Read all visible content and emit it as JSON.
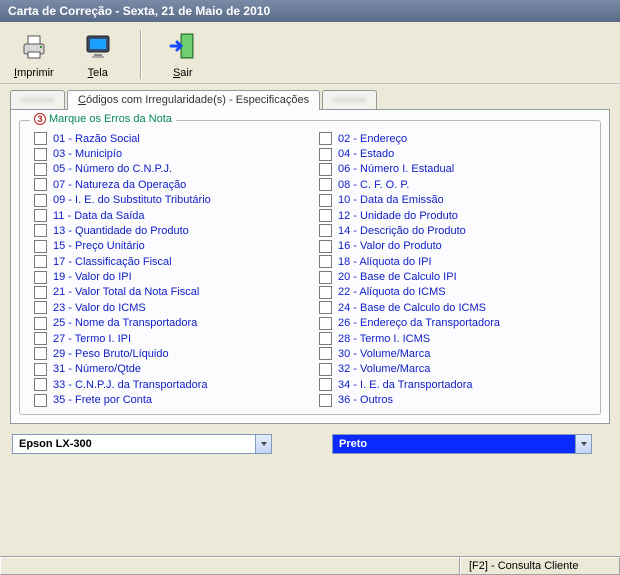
{
  "window": {
    "title": "Carta de Correção - Sexta, 21 de Maio de 2010"
  },
  "toolbar": {
    "print": "Imprimir",
    "screen": "Tela",
    "exit": "Sair"
  },
  "tabs": {
    "tab1": "———",
    "tab2": "Códigos com Irregularidade(s) - Especificações",
    "tab3": "———"
  },
  "fieldset": {
    "badge": "3",
    "legend": "Marque os Erros da Nota"
  },
  "errors_left": [
    "01 - Razão Social",
    "03 - Municipío",
    "05 - Número do C.N.P.J.",
    "07 - Natureza da Operação",
    "09 - I. E. do Substituto Tributário",
    "11 - Data da Saída",
    "13 - Quantidade do Produto",
    "15 - Preço Unitário",
    "17 - Classificação Fiscal",
    "19 - Valor do IPI",
    "21 - Valor Total da Nota Fiscal",
    "23 - Valor do ICMS",
    "25 - Nome da Transportadora",
    "27 - Termo I. IPI",
    "29 - Peso Bruto/Líquido",
    "31 - Número/Qtde",
    "33 - C.N.P.J. da Transportadora",
    "35 - Frete por Conta"
  ],
  "errors_right": [
    "02 - Endereço",
    "04 - Estado",
    "06 - Número I. Estadual",
    "08 - C. F. O. P.",
    "10 - Data da Emissão",
    "12 - Unidade do Produto",
    "14 - Descrição do Produto",
    "16 - Valor do Produto",
    "18 - Alíquota do IPI",
    "20 - Base de Calculo IPI",
    "22 - Alíquota do ICMS",
    "24 - Base de Calculo do ICMS",
    "26 - Endereço da Transportadora",
    "28 - Termo I. ICMS",
    "30 - Volume/Marca",
    "32 - Volume/Marca",
    "34 - I. E. da Transportadora",
    "36 - Outros"
  ],
  "combo_printer": "Epson LX-300",
  "combo_color": "Preto",
  "status": {
    "hint": "[F2] - Consulta Cliente"
  }
}
